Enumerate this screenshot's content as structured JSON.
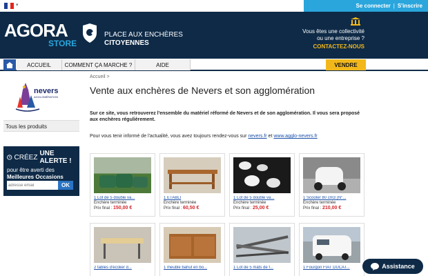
{
  "topbar": {
    "flag_colors": [
      "#1c3f94",
      "#ffffff",
      "#e1251b"
    ],
    "login_label": "Se connecter",
    "separator": "|",
    "register_label": "S'inscrire"
  },
  "header": {
    "logo_main": "AGORA",
    "logo_sub": "STORE",
    "tagline_line1": "PLACE AUX ENCHÈRES",
    "tagline_line2": "CITOYENNES",
    "collect_line1": "Vous êtes une collectivité",
    "collect_line2": "ou une entreprise ?",
    "collect_cta": "CONTACTEZ-NOUS"
  },
  "nav": {
    "items": [
      {
        "label": "ACCUEIL"
      },
      {
        "label": "COMMENT ÇA MARCHE ?"
      },
      {
        "label": "AIDE"
      }
    ],
    "sell_label": "VENDRE"
  },
  "sidebar": {
    "logo_word": "nevers",
    "logo_tag": "AGGLOMÉRATION",
    "link_all_products": "Tous les produits",
    "alert_prefix": "CRÉEZ",
    "alert_bold": "UNE ALERTE !",
    "alert_desc_prefix": "pour être averti des",
    "alert_desc_bold": "Meilleures Occasions",
    "email_placeholder": "adresse email",
    "ok_label": "OK"
  },
  "main": {
    "breadcrumb": "Accueil >",
    "title": "Vente aux enchères de Nevers et son agglomération",
    "intro": "Sur ce site, vous retrouverez l'ensemble du matériel réformé de Nevers et de son agglomération. Il vous sera proposé aux enchères régulièrement.",
    "follow_prefix": "Pour vous tenir informé de l'actualité, vous avez toujours rendez-vous sur",
    "follow_link1": "nevers.fr",
    "follow_mid": "et",
    "follow_link2": "www.agglo-nevers.fr"
  },
  "products": [
    {
      "title": "1 Lot de 5 double va...",
      "status": "Enchère terminée",
      "price_label": "Prix final :",
      "price": "150,00 €",
      "img": "grass"
    },
    {
      "title": "1 ETABLI",
      "status": "Enchère terminée",
      "price_label": "Prix final :",
      "price": "60,50 €",
      "img": "wood"
    },
    {
      "title": "1 Lot de 5 double va...",
      "status": "Enchère terminée",
      "price_label": "Prix final :",
      "price": "25,00 €",
      "img": "white"
    },
    {
      "title": "1 Scooter 80 cm3 (N°...",
      "status": "Enchère terminée",
      "price_label": "Prix final :",
      "price": "210,00 €",
      "img": "scooter"
    },
    {
      "title": "2 tables d'écolier d...",
      "status": "",
      "price_label": "",
      "price": "",
      "img": "table"
    },
    {
      "title": "1 meuble bahut en bo...",
      "status": "",
      "price_label": "",
      "price": "",
      "img": "cabinet"
    },
    {
      "title": "1 Lot de 5 mâts de f...",
      "status": "",
      "price_label": "",
      "price": "",
      "img": "metal"
    },
    {
      "title": "1 Fourgon FIAT DUCAT...",
      "status": "",
      "price_label": "",
      "price": "",
      "img": "van"
    }
  ],
  "assistance": {
    "label": "Assistance"
  }
}
